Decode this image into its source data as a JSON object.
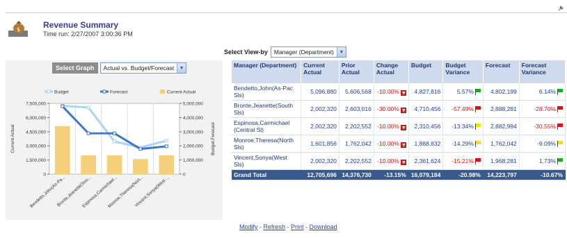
{
  "header": {
    "title": "Revenue Summary",
    "time_run": "Time run: 2/27/2007 3:00:36 PM"
  },
  "view_by": {
    "label": "Select View-by",
    "selected": "Manager (Department)"
  },
  "graph": {
    "button_label": "Select Graph",
    "selected": "Actual vs. Budget/Forecast"
  },
  "chart_data": {
    "type": "bar",
    "categories": [
      "Bendetto,John(As-Pa...",
      "Bronte,Jeanette(Sou...",
      "Espinosa,Carmichael...",
      "Monroe,Theresa(Nort...",
      "Vincent,Sonya(West ..."
    ],
    "series": [
      {
        "name": "Current Actual",
        "type": "bar",
        "axis": "left",
        "values": [
          5096880,
          2002320,
          2002320,
          1601856,
          2002320
        ],
        "color": "#f5cf7a"
      },
      {
        "name": "Budget",
        "type": "line",
        "axis": "right",
        "values": [
          4827818,
          4710456,
          2310456,
          1888832,
          2361624
        ],
        "color": "#a9d4f5"
      },
      {
        "name": "Forecast",
        "type": "line",
        "axis": "right",
        "values": [
          4802199,
          2888281,
          2882994,
          1782042,
          1968281
        ],
        "color": "#3f78c8"
      }
    ],
    "ylabel": "Current Actual",
    "y2label": "Budget,Forecast",
    "ylim": [
      0,
      7500000
    ],
    "y2lim": [
      0,
      5000000
    ],
    "yticks": [
      "7,500,000",
      "6,000,000",
      "4,500,000",
      "3,000,000",
      "1,500,000",
      "0"
    ],
    "y2ticks": [
      "5,000,000",
      "4,000,000",
      "3,000,000",
      "2,000,000",
      "1,000,000",
      "0"
    ],
    "legend": [
      "Budget",
      "Forecast",
      "Current Actual"
    ],
    "legend_position": "top",
    "grid": true
  },
  "table": {
    "headers": [
      "Manager (Department)",
      "Current Actual",
      "Prior Actual",
      "Change Actual",
      "Budget",
      "Budget Variance",
      "Forecast",
      "Forecast Variance"
    ],
    "rows": [
      {
        "manager": "Bendetto,John(As-Pac Sls)",
        "current": "5,096,880",
        "prior": "5,606,568",
        "change": "-10.00%",
        "budget": "4,827,816",
        "bvar": "5.57%",
        "bflag": "green",
        "forecast": "4,802,199",
        "fvar": "6.14%",
        "fflag": "green"
      },
      {
        "manager": "Bronte,Jeanette(South Sls)",
        "current": "2,002,320",
        "prior": "2,603,016",
        "change": "-30.00%",
        "budget": "4,710,456",
        "bvar": "-57.49%",
        "bflag": "red",
        "forecast": "2,888,281",
        "fvar": "-28.70%",
        "fflag": "red"
      },
      {
        "manager": "Espinosa,Carmichael (Central Sl)",
        "current": "2,002,320",
        "prior": "2,202,552",
        "change": "-10.00%",
        "budget": "2,310,456",
        "bvar": "-13.34%",
        "bflag": "yellow",
        "forecast": "2,882,994",
        "fvar": "-30.55%",
        "fflag": "red"
      },
      {
        "manager": "Monroe,Theresa(North Sls)",
        "current": "1,601,856",
        "prior": "1,762,042",
        "change": "-10.00%",
        "budget": "1,888,832",
        "bvar": "-14.29%",
        "bflag": "yellow",
        "forecast": "1,762,042",
        "fvar": "-9.09%",
        "fflag": "yellow"
      },
      {
        "manager": "Vincent,Sonya(West Sls)",
        "current": "2,002,320",
        "prior": "2,202,552",
        "change": "-10.00%",
        "budget": "2,361,624",
        "bvar": "-15.21%",
        "bflag": "red",
        "forecast": "1,968,281",
        "fvar": "1.73%",
        "fflag": "green"
      }
    ],
    "total": {
      "label": "Grand Total",
      "current": "12,705,696",
      "prior": "14,376,730",
      "change": "-13.15%",
      "budget": "16,079,184",
      "bvar": "-20.98%",
      "forecast": "14,223,797",
      "fvar": "-10.67%"
    }
  },
  "links": {
    "modify": "Modify",
    "refresh": "Refresh",
    "print": "Print",
    "download": "Download",
    "sep": " - "
  },
  "colors": {
    "header_bg": "#cfdaee",
    "total_bg": "#3b5a8c",
    "negative": "#dd1111",
    "value": "#1f3f9c"
  }
}
